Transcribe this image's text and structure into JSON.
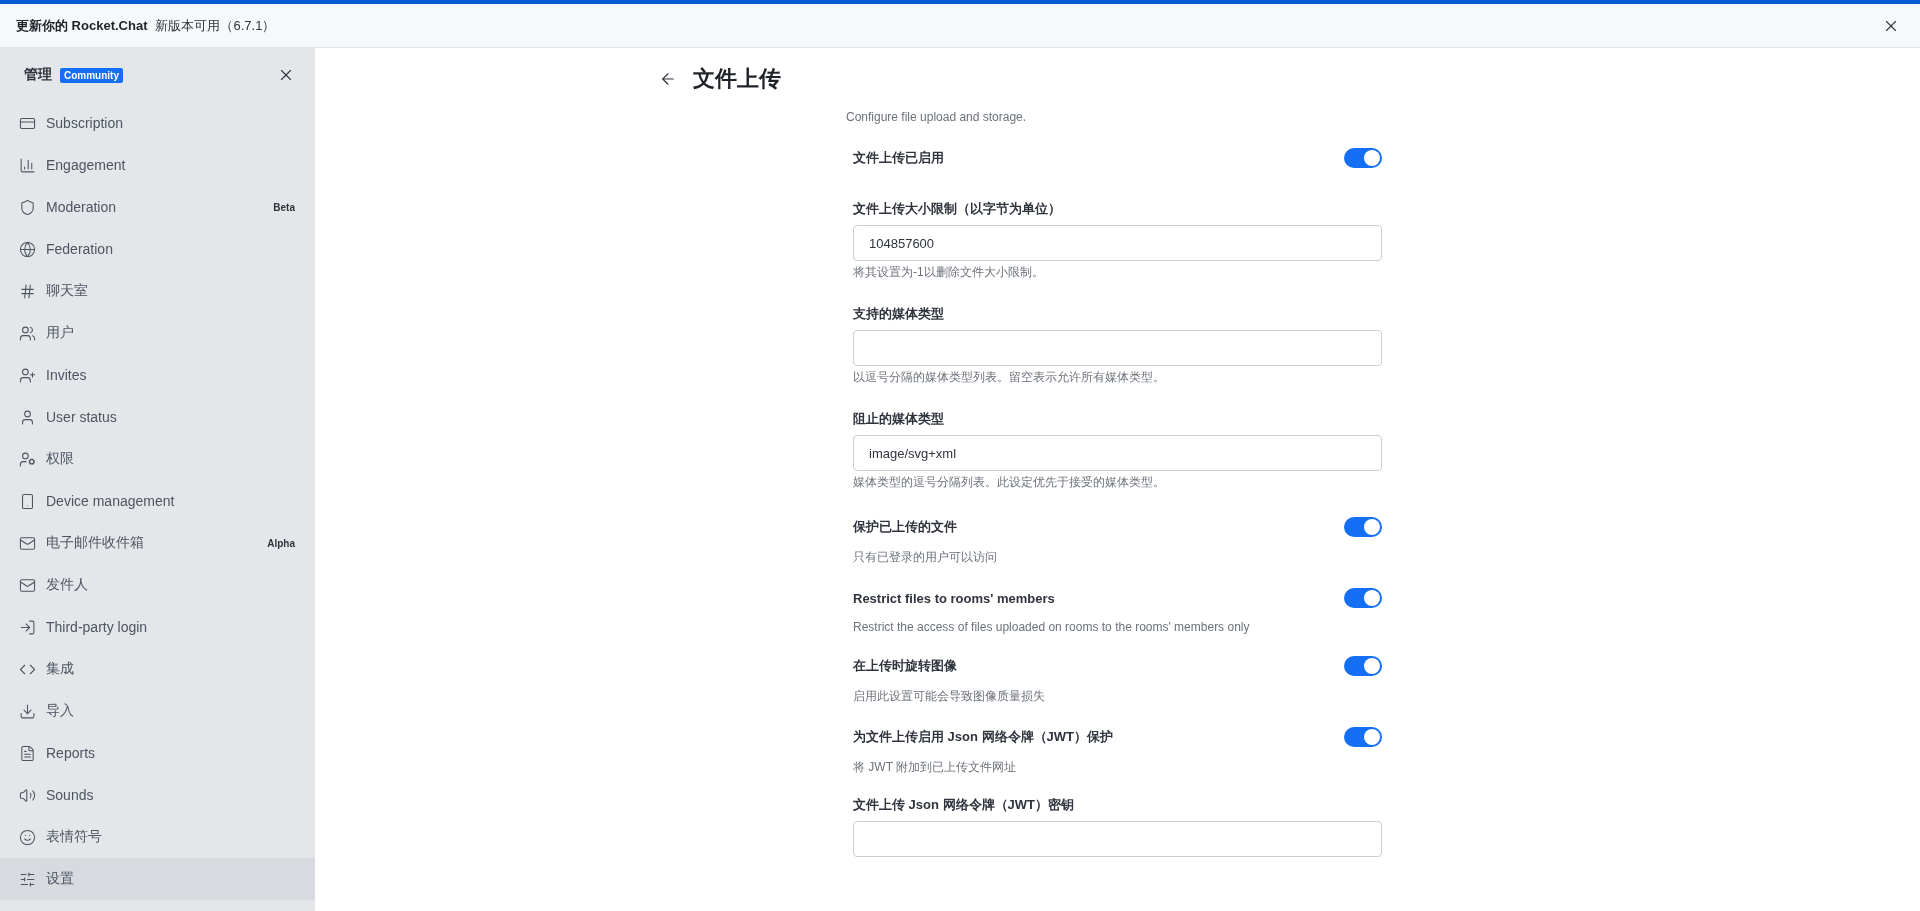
{
  "banner": {
    "title": "更新你的 Rocket.Chat",
    "message": "新版本可用（6.7.1）"
  },
  "sidebar": {
    "title": "管理",
    "badge": "Community",
    "items": [
      {
        "kind": "subscription",
        "label": "Subscription",
        "selected": false
      },
      {
        "kind": "engagement",
        "label": "Engagement",
        "selected": false
      },
      {
        "kind": "moderation",
        "label": "Moderation",
        "tag": "Beta",
        "selected": false
      },
      {
        "kind": "federation",
        "label": "Federation",
        "selected": false
      },
      {
        "kind": "rooms",
        "label": "聊天室",
        "selected": false
      },
      {
        "kind": "users",
        "label": "用户",
        "selected": false
      },
      {
        "kind": "invites",
        "label": "Invites",
        "selected": false
      },
      {
        "kind": "user-status",
        "label": "User status",
        "selected": false
      },
      {
        "kind": "permissions",
        "label": "权限",
        "selected": false
      },
      {
        "kind": "device",
        "label": "Device management",
        "selected": false
      },
      {
        "kind": "mail",
        "label": "电子邮件收件箱",
        "tag": "Alpha",
        "selected": false
      },
      {
        "kind": "mail",
        "label": "发件人",
        "selected": false
      },
      {
        "kind": "login",
        "label": "Third-party login",
        "selected": false
      },
      {
        "kind": "integrations",
        "label": "集成",
        "selected": false
      },
      {
        "kind": "import",
        "label": "导入",
        "selected": false
      },
      {
        "kind": "reports",
        "label": "Reports",
        "selected": false
      },
      {
        "kind": "sounds",
        "label": "Sounds",
        "selected": false
      },
      {
        "kind": "emoji",
        "label": "表情符号",
        "selected": false
      },
      {
        "kind": "settings",
        "label": "设置",
        "selected": true
      }
    ]
  },
  "page": {
    "title": "文件上传",
    "description": "Configure file upload and storage.",
    "settings": [
      {
        "kind": "toggle",
        "label": "文件上传已启用",
        "on": true
      },
      {
        "kind": "text",
        "label": "文件上传大小限制（以字节为单位）",
        "value": "104857600",
        "hint": "将其设置为-1以删除文件大小限制。"
      },
      {
        "kind": "text",
        "label": "支持的媒体类型",
        "hint": "以逗号分隔的媒体类型列表。留空表示允许所有媒体类型。"
      },
      {
        "kind": "text",
        "label": "阻止的媒体类型",
        "value": "image/svg+xml",
        "hint": "媒体类型的逗号分隔列表。此设定优先于接受的媒体类型。"
      },
      {
        "kind": "toggle",
        "label": "保护已上传的文件",
        "hint": "只有已登录的用户可以访问",
        "on": true
      },
      {
        "kind": "toggle",
        "label": "Restrict files to rooms' members",
        "hint": "Restrict the access of files uploaded on rooms to the rooms' members only",
        "on": true
      },
      {
        "kind": "toggle",
        "label": "在上传时旋转图像",
        "hint": "启用此设置可能会导致图像质量损失",
        "on": true
      },
      {
        "kind": "toggle",
        "label": "为文件上传启用 Json 网络令牌（JWT）保护",
        "hint": "将 JWT 附加到已上传文件网址",
        "on": true
      },
      {
        "kind": "text",
        "label": "文件上传 Json 网络令牌（JWT）密钥"
      }
    ]
  }
}
